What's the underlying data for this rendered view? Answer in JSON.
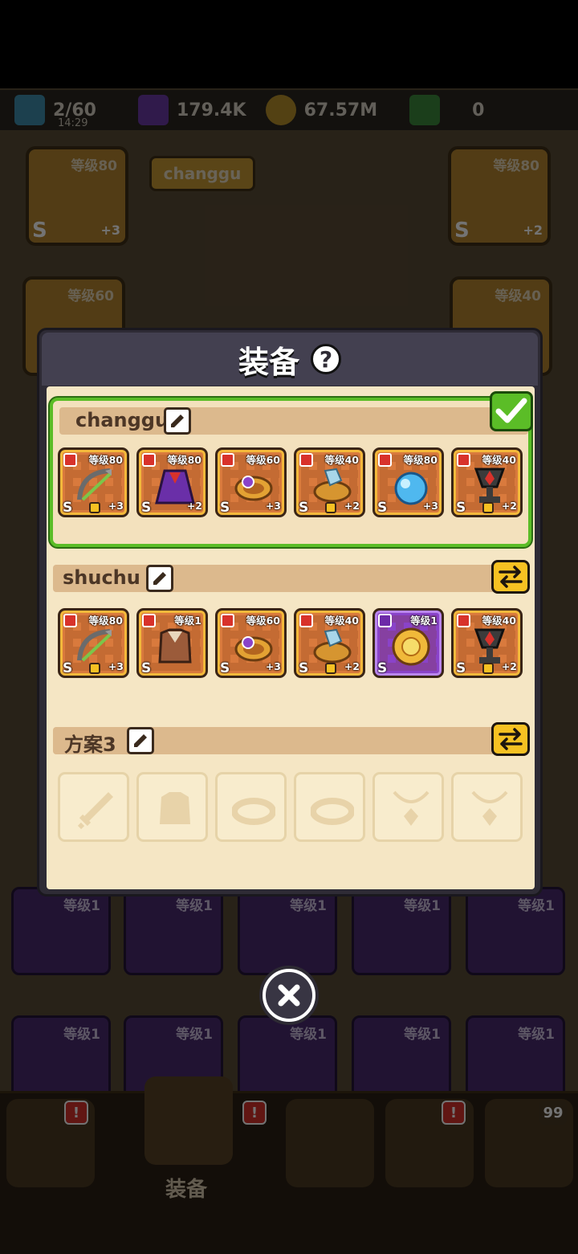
{
  "resources": {
    "stamina": "2/60",
    "stamina_timer": "14:29",
    "gems": "179.4K",
    "coins": "67.57M",
    "green": "0"
  },
  "background": {
    "user_button": "changgu",
    "left_card_level": "等级80",
    "left_card_plus": "+3",
    "right_card_level": "等级80",
    "right_card_plus": "+2",
    "left_card2_level": "等级60",
    "right_card2_level": "等级40",
    "grid_levels": [
      "等级1",
      "等级1",
      "等级1",
      "等级1",
      "等级1"
    ],
    "grid_levels_row2": [
      "等级1",
      "等级1",
      "等级1",
      "等级1",
      "等级1"
    ],
    "bottom_nav_label": "装备",
    "bottom_badge_count": "99",
    "s_label": "S"
  },
  "modal": {
    "title": "装备",
    "help_label": "?",
    "presets": [
      {
        "name": "changgu",
        "slots": [
          {
            "icon": "bow-icon",
            "level": "等级80",
            "plus": "+3",
            "locked": true
          },
          {
            "icon": "cape-icon",
            "level": "等级80",
            "plus": "+2",
            "locked": false
          },
          {
            "icon": "ring-icon",
            "level": "等级60",
            "plus": "+3",
            "locked": false
          },
          {
            "icon": "crystal-ring-icon",
            "level": "等级40",
            "plus": "+2",
            "locked": true
          },
          {
            "icon": "orb-icon",
            "level": "等级80",
            "plus": "+3",
            "locked": false
          },
          {
            "icon": "chalice-icon",
            "level": "等级40",
            "plus": "+2",
            "locked": true
          }
        ]
      },
      {
        "name": "shuchu",
        "slots": [
          {
            "icon": "bow-icon",
            "level": "等级80",
            "plus": "+3",
            "locked": true
          },
          {
            "icon": "leather-armor-icon",
            "level": "等级1",
            "plus": "",
            "locked": false
          },
          {
            "icon": "ring-icon",
            "level": "等级60",
            "plus": "+3",
            "locked": false
          },
          {
            "icon": "crystal-ring-icon",
            "level": "等级40",
            "plus": "+2",
            "locked": true
          },
          {
            "icon": "sun-medallion-icon",
            "level": "等级1",
            "plus": "",
            "locked": false
          },
          {
            "icon": "chalice-icon",
            "level": "等级40",
            "plus": "+2",
            "locked": true
          }
        ]
      },
      {
        "name": "方案3",
        "empty_slots": [
          "sword-slot-icon",
          "armor-slot-icon",
          "ring-slot-icon",
          "ring-slot-icon",
          "necklace-slot-icon",
          "necklace-slot-icon"
        ]
      }
    ]
  },
  "s_grade": "S",
  "colors": {
    "active_border": "#5bbd27",
    "slot_orange": "#d97a3d",
    "slot_purple": "#8a43c9",
    "swap_yellow": "#f6c122"
  }
}
